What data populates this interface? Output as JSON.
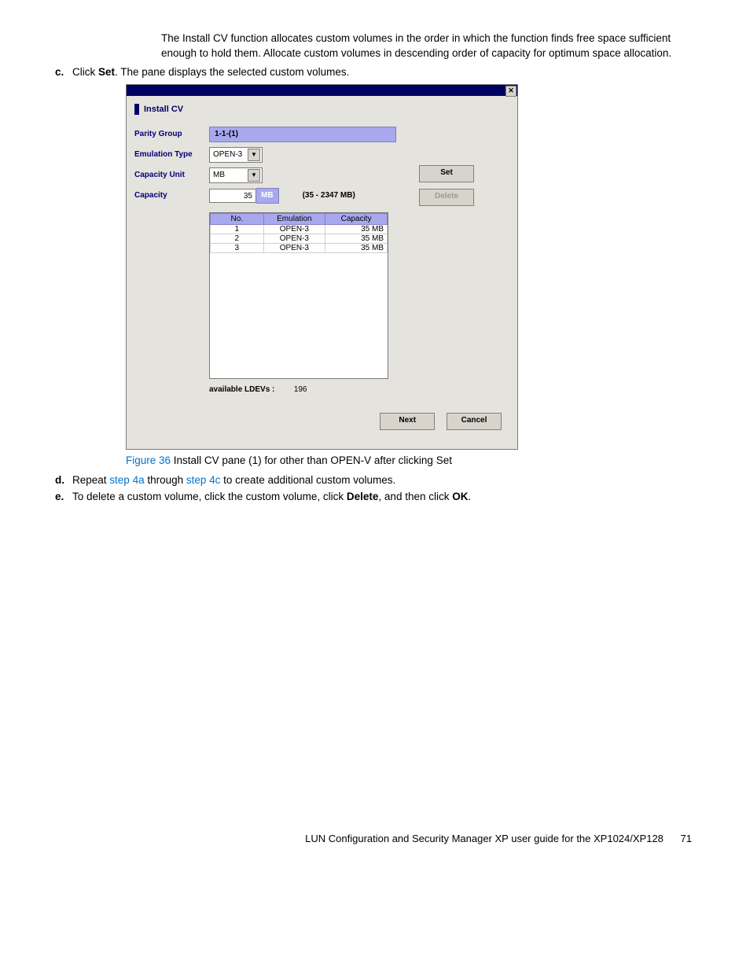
{
  "paragraphs": {
    "intro": "The Install CV function allocates custom volumes in the order in which the function finds free space sufficient enough to hold them. Allocate custom volumes in descending order of capacity for optimum space allocation.",
    "step_c_pre": "Click ",
    "step_c_bold": "Set",
    "step_c_post": ". The pane displays the selected custom volumes.",
    "step_d_pre": "Repeat ",
    "step_d_link1": "step 4a",
    "step_d_mid": " through ",
    "step_d_link2": "step 4c",
    "step_d_post": " to create additional custom volumes.",
    "step_e_pre": "To delete a custom volume, click the custom volume, click ",
    "step_e_b1": "Delete",
    "step_e_mid": ", and then click ",
    "step_e_b2": "OK",
    "step_e_post": "."
  },
  "markers": {
    "c": "c.",
    "d": "d.",
    "e": "e."
  },
  "figure": {
    "label": "Figure 36",
    "caption": " Install CV pane (1) for other than OPEN-V after clicking Set"
  },
  "dialog": {
    "title": "Install CV",
    "labels": {
      "parity": "Parity Group",
      "emu": "Emulation Type",
      "unit": "Capacity Unit",
      "cap": "Capacity"
    },
    "parity_value": "1-1-(1)",
    "emu_value": "OPEN-3",
    "unit_value": "MB",
    "cap_value": "35",
    "cap_unit": "MB",
    "cap_range": "(35 - 2347 MB)",
    "table": {
      "headers": {
        "no": "No.",
        "emu": "Emulation",
        "cap": "Capacity"
      },
      "rows": [
        {
          "no": "1",
          "emu": "OPEN-3",
          "cap": "35 MB"
        },
        {
          "no": "2",
          "emu": "OPEN-3",
          "cap": "35 MB"
        },
        {
          "no": "3",
          "emu": "OPEN-3",
          "cap": "35 MB"
        }
      ]
    },
    "avail_label": "available LDEVs :",
    "avail_value": "196",
    "buttons": {
      "set": "Set",
      "delete": "Delete",
      "next": "Next",
      "cancel": "Cancel"
    }
  },
  "footer": {
    "text": "LUN Configuration and Security Manager XP user guide for the XP1024/XP128",
    "page": "71"
  }
}
